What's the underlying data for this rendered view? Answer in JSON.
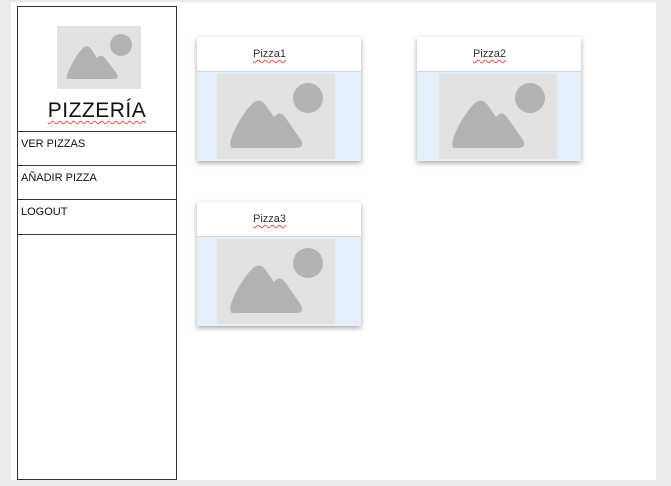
{
  "sidebar": {
    "brand": "PIZZERÍA",
    "logo_icon": "image-placeholder-icon",
    "menu": [
      {
        "label": "VER PIZZAS"
      },
      {
        "label": "AÑADIR PIZZA"
      },
      {
        "label": "LOGOUT"
      }
    ]
  },
  "main": {
    "cards": [
      {
        "title": "Pizza1",
        "image_icon": "image-placeholder-icon"
      },
      {
        "title": "Pizza2",
        "image_icon": "image-placeholder-icon"
      },
      {
        "title": "Pizza3",
        "image_icon": "image-placeholder-icon"
      }
    ]
  },
  "colors": {
    "card_body": "#e3f0fb",
    "placeholder": "#e2e2e2",
    "placeholder_glyph": "#b3b3b3"
  }
}
